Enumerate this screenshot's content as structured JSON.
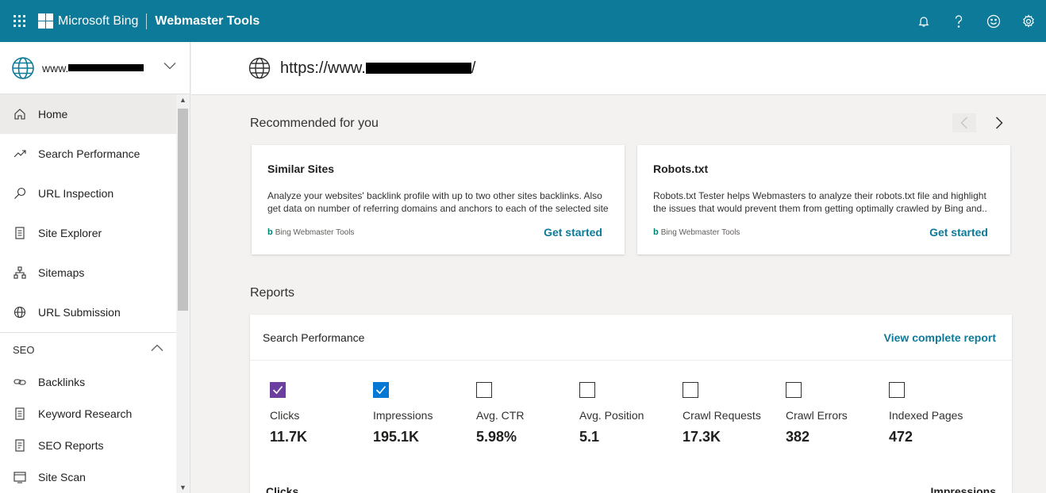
{
  "topbar": {
    "brand": "Microsoft Bing",
    "product": "Webmaster Tools",
    "icons": [
      "waffle-icon",
      "bell-icon",
      "help-icon",
      "feedback-smiley-icon",
      "settings-gear-icon"
    ],
    "color": "#0e7a99"
  },
  "sidebar": {
    "site_prefix": "www.",
    "items": [
      {
        "label": "Home",
        "icon": "home-icon",
        "active": true
      },
      {
        "label": "Search Performance",
        "icon": "trend-icon"
      },
      {
        "label": "URL Inspection",
        "icon": "search-icon"
      },
      {
        "label": "Site Explorer",
        "icon": "document-icon"
      },
      {
        "label": "Sitemaps",
        "icon": "sitemap-icon"
      },
      {
        "label": "URL Submission",
        "icon": "globe-icon"
      }
    ],
    "group": {
      "label": "SEO",
      "items": [
        {
          "label": "Backlinks",
          "icon": "link-icon"
        },
        {
          "label": "Keyword Research",
          "icon": "document-icon"
        },
        {
          "label": "SEO Reports",
          "icon": "report-icon"
        },
        {
          "label": "Site Scan",
          "icon": "scan-icon"
        }
      ]
    }
  },
  "url_header": {
    "prefix": "https://www.",
    "suffix": "/"
  },
  "recommended": {
    "title": "Recommended for you",
    "cards": [
      {
        "title": "Similar Sites",
        "desc": "Analyze your websites' backlink profile with up to two other sites backlinks. Also get data on number of referring domains and anchors to each of the selected site",
        "brand": "Bing Webmaster Tools",
        "cta": "Get started"
      },
      {
        "title": "Robots.txt",
        "desc": "Robots.txt Tester helps Webmasters to analyze their robots.txt file and highlight the issues that would prevent them from getting optimally crawled by Bing and..",
        "brand": "Bing Webmaster Tools",
        "cta": "Get started"
      }
    ]
  },
  "reports": {
    "title": "Reports",
    "panel_title": "Search Performance",
    "link": "View complete report",
    "metrics": [
      {
        "label": "Clicks",
        "value": "11.7K",
        "checked": true,
        "color": "#6b3fa0"
      },
      {
        "label": "Impressions",
        "value": "195.1K",
        "checked": true,
        "color": "#0078d4"
      },
      {
        "label": "Avg. CTR",
        "value": "5.98%",
        "checked": false
      },
      {
        "label": "Avg. Position",
        "value": "5.1",
        "checked": false
      },
      {
        "label": "Crawl Requests",
        "value": "17.3K",
        "checked": false
      },
      {
        "label": "Crawl Errors",
        "value": "382",
        "checked": false
      },
      {
        "label": "Indexed Pages",
        "value": "472",
        "checked": false
      }
    ],
    "chart_left_label": "Clicks",
    "chart_right_label": "Impressions"
  }
}
